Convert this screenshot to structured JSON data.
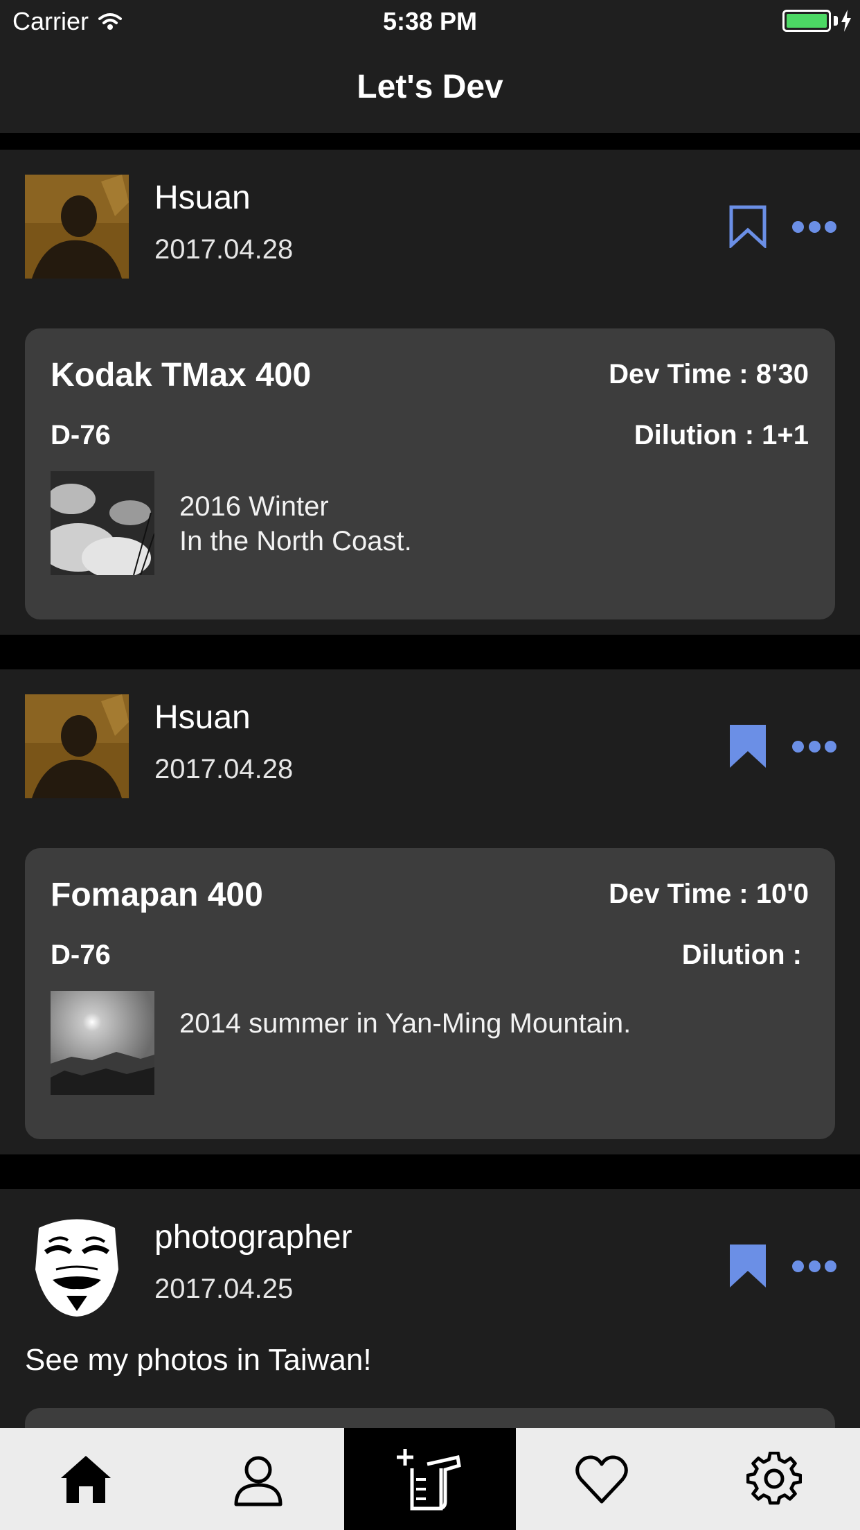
{
  "status_bar": {
    "carrier": "Carrier",
    "time": "5:38 PM"
  },
  "nav": {
    "title": "Let's Dev"
  },
  "colors": {
    "accent": "#6b8fe6",
    "card_bg": "#3d3d3d",
    "post_bg": "#1e1e1e",
    "battery": "#4cd964"
  },
  "posts": [
    {
      "username": "Hsuan",
      "date": "2017.04.28",
      "bookmarked": false,
      "film": "Kodak TMax 400",
      "dev_time": "Dev Time : 8'30",
      "developer": "D-76",
      "dilution": "Dilution : 1+1",
      "caption_line1": "2016 Winter",
      "caption_line2": "In the North Coast."
    },
    {
      "username": "Hsuan",
      "date": "2017.04.28",
      "bookmarked": true,
      "film": "Fomapan 400",
      "dev_time": "Dev Time : 10'0",
      "developer": "D-76",
      "dilution": "Dilution :",
      "caption_line1": "2014 summer in Yan-Ming Mountain."
    },
    {
      "username": "photographer",
      "date": "2017.04.25",
      "bookmarked": true,
      "text": "See my photos in Taiwan!"
    }
  ],
  "tabs": [
    {
      "icon": "home-icon",
      "active": false
    },
    {
      "icon": "profile-icon",
      "active": false
    },
    {
      "icon": "add-record-icon",
      "active": true
    },
    {
      "icon": "heart-icon",
      "active": false
    },
    {
      "icon": "settings-icon",
      "active": false
    }
  ]
}
